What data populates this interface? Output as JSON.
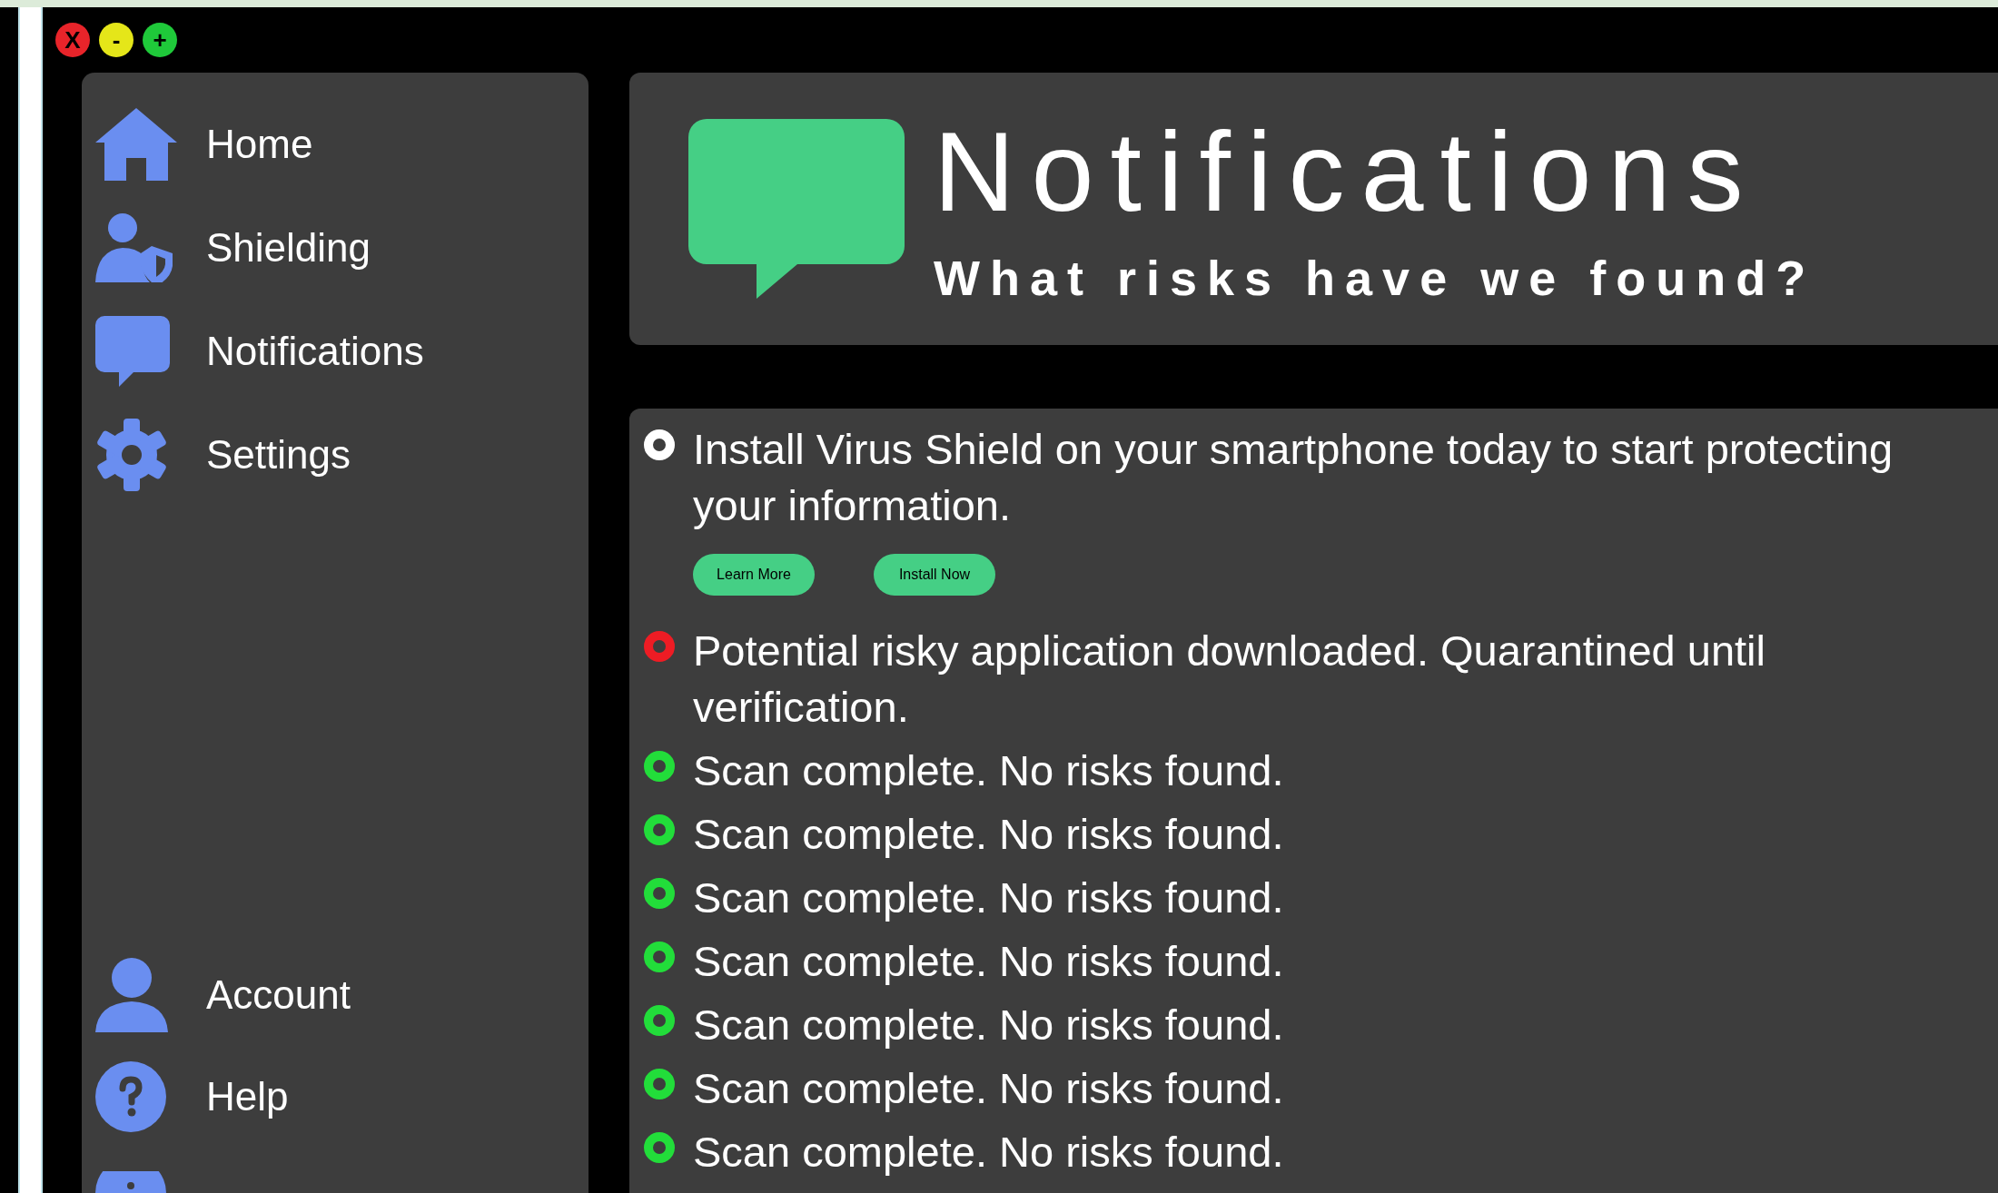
{
  "window_controls": [
    {
      "symbol": "X",
      "color": "#e8242a"
    },
    {
      "symbol": "-",
      "color": "#e5e619"
    },
    {
      "symbol": "+",
      "color": "#1fc93a"
    }
  ],
  "sidebar": {
    "items": [
      {
        "label": "Home"
      },
      {
        "label": "Shielding"
      },
      {
        "label": "Notifications"
      },
      {
        "label": "Settings"
      }
    ],
    "bottom_items": [
      {
        "label": "Account"
      },
      {
        "label": "Help"
      },
      {
        "kind": "partial"
      }
    ]
  },
  "header": {
    "title": "Notifications",
    "subtitle": "What risks have we found?"
  },
  "notifications": [
    {
      "text": "Install Virus Shield on your smartphone today to start protecting your information.",
      "color": "#ffffff",
      "buttons": [
        "Learn More",
        "Install Now"
      ]
    },
    {
      "text": "Potential risky application downloaded. Quarantined until verification.",
      "color": "#ee1c24"
    },
    {
      "text": "Scan complete. No risks found.",
      "color": "#22dd3a"
    },
    {
      "text": "Scan complete. No risks found.",
      "color": "#22dd3a"
    },
    {
      "text": "Scan complete. No risks found.",
      "color": "#22dd3a"
    },
    {
      "text": "Scan complete. No risks found.",
      "color": "#22dd3a"
    },
    {
      "text": "Scan complete. No risks found.",
      "color": "#22dd3a"
    },
    {
      "text": "Scan complete. No risks found.",
      "color": "#22dd3a"
    },
    {
      "text": "Scan complete. No risks found.",
      "color": "#22dd3a"
    }
  ]
}
